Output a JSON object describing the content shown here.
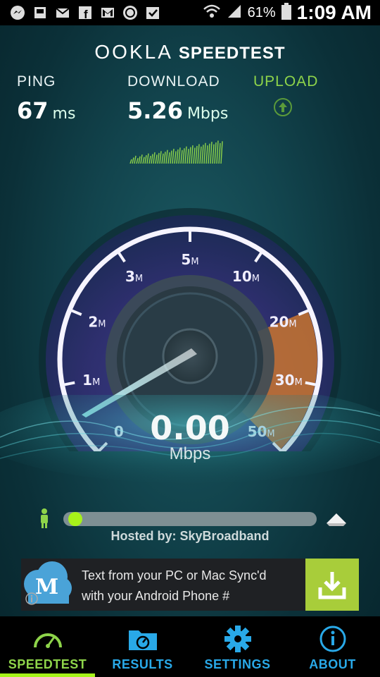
{
  "status_bar": {
    "icons": [
      "messenger-icon",
      "inbox-icon",
      "email-icon",
      "facebook-icon",
      "gmail-icon",
      "wordpress-icon",
      "checkbox-icon"
    ],
    "battery_pct": "61%",
    "time": "1:09 AM"
  },
  "header": {
    "brand_ookla": "OOKLA",
    "brand_speedtest": "SPEEDTEST"
  },
  "metrics": {
    "ping": {
      "label": "PING",
      "value": "67",
      "unit": "ms"
    },
    "download": {
      "label": "DOWNLOAD",
      "value": "5.26",
      "unit": "Mbps"
    },
    "upload": {
      "label": "UPLOAD"
    }
  },
  "gauge": {
    "ticks": [
      {
        "num": "0",
        "suffix": ""
      },
      {
        "num": "1",
        "suffix": "M"
      },
      {
        "num": "2",
        "suffix": "M"
      },
      {
        "num": "3",
        "suffix": "M"
      },
      {
        "num": "5",
        "suffix": "M"
      },
      {
        "num": "10",
        "suffix": "M"
      },
      {
        "num": "20",
        "suffix": "M"
      },
      {
        "num": "30",
        "suffix": "M"
      },
      {
        "num": "50",
        "suffix": "M"
      }
    ],
    "current_value": "0.00",
    "current_unit": "Mbps"
  },
  "progress": {
    "fraction": 0.02
  },
  "hosted_by": "Hosted by: SkyBroadband",
  "ad": {
    "line1": "Text from your PC or Mac Sync'd",
    "line2": "with your Android Phone #",
    "logo_letter": "M"
  },
  "nav": [
    {
      "label": "SPEEDTEST",
      "icon": "speedometer-icon",
      "active": true
    },
    {
      "label": "RESULTS",
      "icon": "results-folder-icon",
      "active": false
    },
    {
      "label": "SETTINGS",
      "icon": "gear-icon",
      "active": false
    },
    {
      "label": "ABOUT",
      "icon": "info-icon",
      "active": false
    }
  ],
  "colors": {
    "accent_green": "#8ed44a",
    "nav_blue": "#29a9e8",
    "gauge_orange": "#d2782e"
  }
}
